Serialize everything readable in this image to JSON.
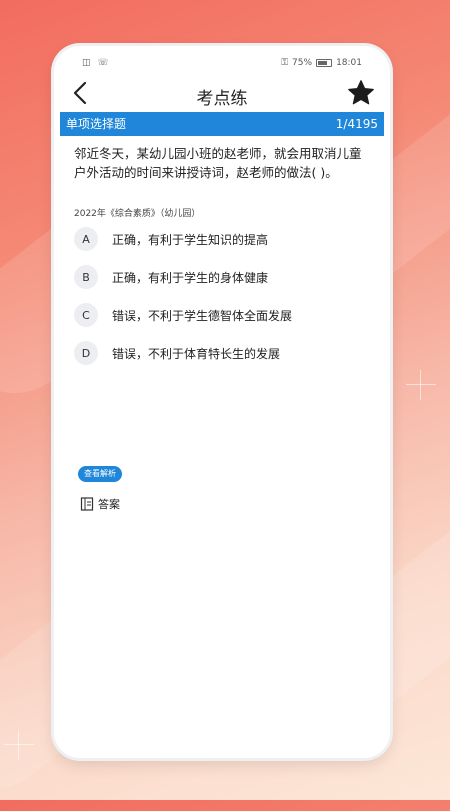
{
  "status_bar": {
    "left_icons": "◫ ☏",
    "signal": "⚿",
    "battery": "75%",
    "time": "18:01"
  },
  "header": {
    "title": "考点练",
    "back_icon": "chevron-left",
    "favorite_icon": "star"
  },
  "question_bar": {
    "type": "单项选择题",
    "counter": "1/4195"
  },
  "question": {
    "text": "邻近冬天，某幼儿园小班的赵老师，就会用取消儿童户外活动的时间来讲授诗词，赵老师的做法( )。",
    "source": "2022年《综合素质》（幼儿园）"
  },
  "options": [
    {
      "letter": "A",
      "text": "正确，有利于学生知识的提高"
    },
    {
      "letter": "B",
      "text": "正确，有利于学生的身体健康"
    },
    {
      "letter": "C",
      "text": "错误，不利于学生德智体全面发展"
    },
    {
      "letter": "D",
      "text": "错误，不利于体育特长生的发展"
    }
  ],
  "analysis_button": "查看解析",
  "answer_label": "答案",
  "colors": {
    "accent": "#1f86d9",
    "background_top": "#f26c5f",
    "background_bottom": "#fde7d8"
  }
}
